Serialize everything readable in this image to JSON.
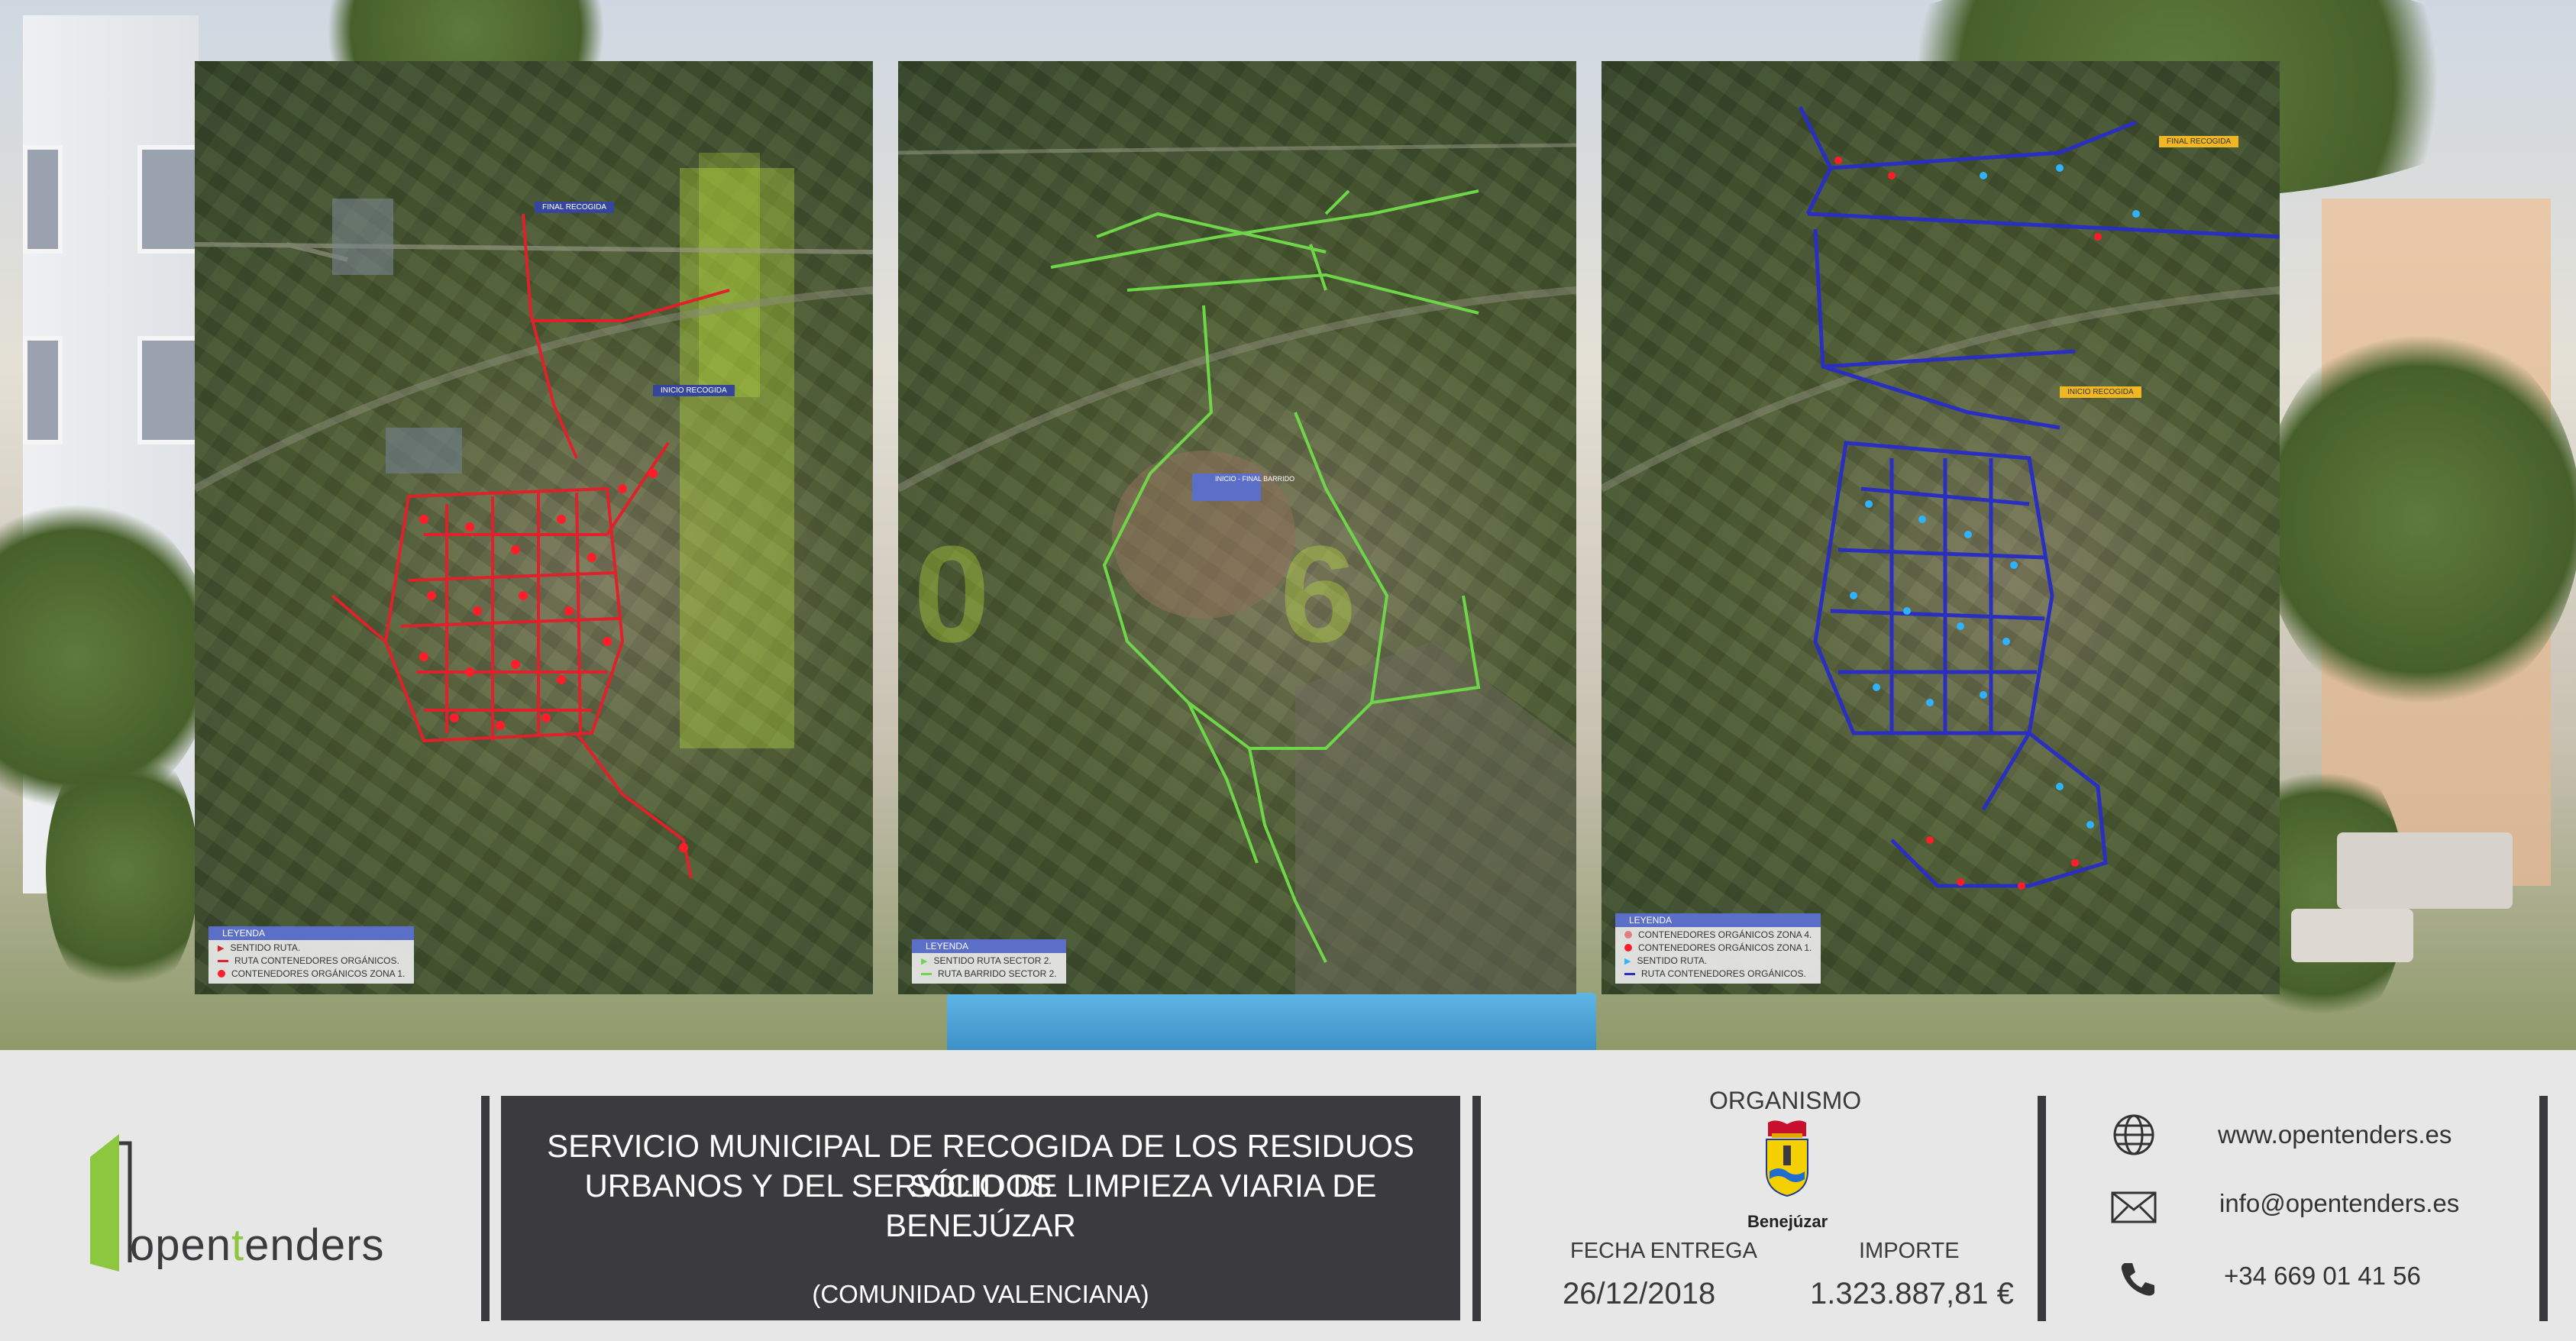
{
  "brand": {
    "name_part1": "open",
    "name_part2": "t",
    "name_part3": "enders"
  },
  "title": {
    "line1": "SERVICIO MUNICIPAL DE RECOGIDA DE LOS RESIDUOS SÓLIDOS",
    "line2": "URBANOS Y DEL SERVICIO DE LIMPIEZA VIARIA DE BENEJÚZAR",
    "region": "(COMUNIDAD VALENCIANA)"
  },
  "organism": {
    "heading": "ORGANISMO",
    "name": "Benejúzar",
    "date_label": "FECHA ENTREGA",
    "date_value": "26/12/2018",
    "amount_label": "IMPORTE",
    "amount_value": "1.323.887,81 €"
  },
  "contact": {
    "web": "www.opentenders.es",
    "email": "info@opentenders.es",
    "phone": "+34 669 01 41 56"
  },
  "maps": [
    {
      "label_end": "FINAL RECOGIDA",
      "label_start": "INICIO RECOGIDA",
      "legend_title": "LEYENDA",
      "legend_items": [
        "SENTIDO RUTA.",
        "RUTA CONTENEDORES ORGÁNICOS.",
        "CONTENEDORES ORGÁNICOS ZONA 1."
      ]
    },
    {
      "label_start": "INICIO - FINAL BARRIDO",
      "legend_title": "LEYENDA",
      "legend_items": [
        "SENTIDO RUTA SECTOR 2.",
        "RUTA BARRIDO SECTOR 2."
      ]
    },
    {
      "label_end": "FINAL RECOGIDA",
      "label_start": "INICIO RECOGIDA",
      "legend_title": "LEYENDA",
      "legend_items": [
        "CONTENEDORES ORGÁNICOS ZONA 4.",
        "CONTENEDORES ORGÁNICOS ZONA 1.",
        "SENTIDO RUTA.",
        "RUTA CONTENEDORES ORGÁNICOS."
      ]
    }
  ],
  "colors": {
    "accent_green": "#8dc63f",
    "dark": "#3b3b3d",
    "route_red": "#e0202a",
    "route_green": "#6fd64a",
    "route_blue": "#2a2fc0"
  }
}
